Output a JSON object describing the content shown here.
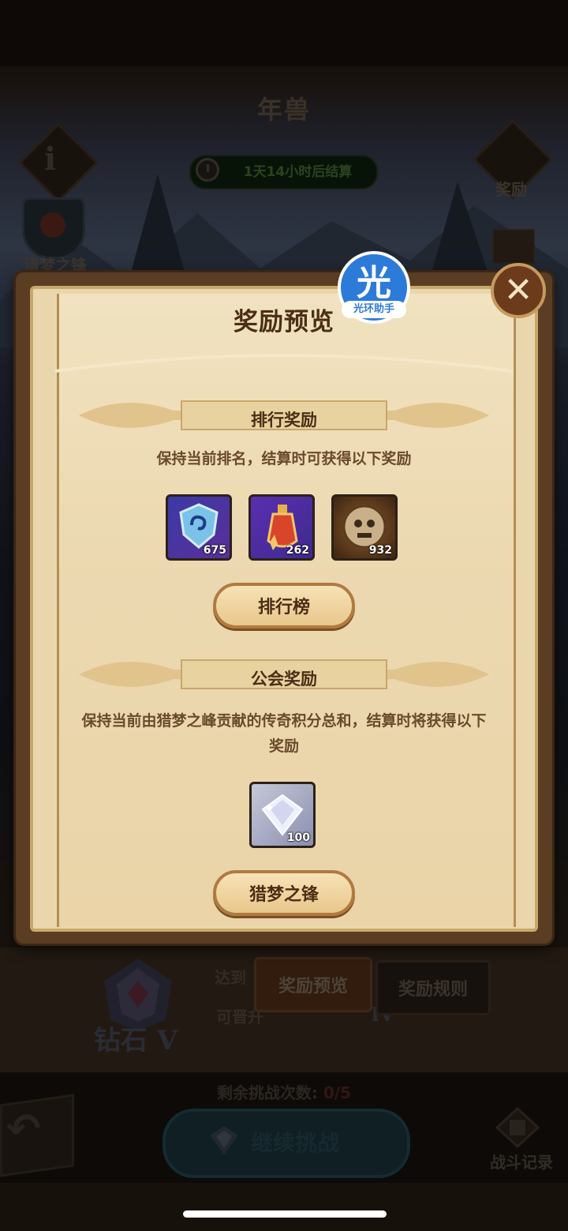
{
  "header": {
    "title": "年兽",
    "timer_text": "1天14小时后结算",
    "reward_label": "奖励",
    "guild_label": "猎梦之锋"
  },
  "modal": {
    "title": "奖励预览",
    "badge_char": "光",
    "badge_label": "光环助手",
    "close_symbol": "✕",
    "rank_section": {
      "ribbon_title": "排行奖励",
      "description": "保持当前排名，结算时可获得以下奖励",
      "items": [
        {
          "icon": "shield-swirl-icon",
          "count": "675"
        },
        {
          "icon": "potion-bottle-icon",
          "count": "262"
        },
        {
          "icon": "skull-coin-icon",
          "count": "932"
        }
      ],
      "button_label": "排行榜"
    },
    "guild_section": {
      "ribbon_title": "公会奖励",
      "description": "保持当前由猎梦之峰贡献的传奇积分总和，结算时将获得以下奖励",
      "items": [
        {
          "icon": "diamond-icon",
          "count": "100"
        }
      ],
      "button_label": "猎梦之锋"
    }
  },
  "bottom": {
    "rank_name": "钻石 V",
    "reach_text": "达到",
    "promote_text": "可晋升",
    "next_rank_suffix": "IV",
    "tab_preview": "奖励预览",
    "tab_rules": "奖励规则",
    "remain_label": "剩余挑战次数:",
    "remain_value": "0/5",
    "continue_label": "继续挑战",
    "record_label": "战斗记录"
  },
  "colors": {
    "modal_paper": "#ecd9b1",
    "title_brown": "#4b2e15",
    "badge_blue": "#2d7bd9"
  }
}
